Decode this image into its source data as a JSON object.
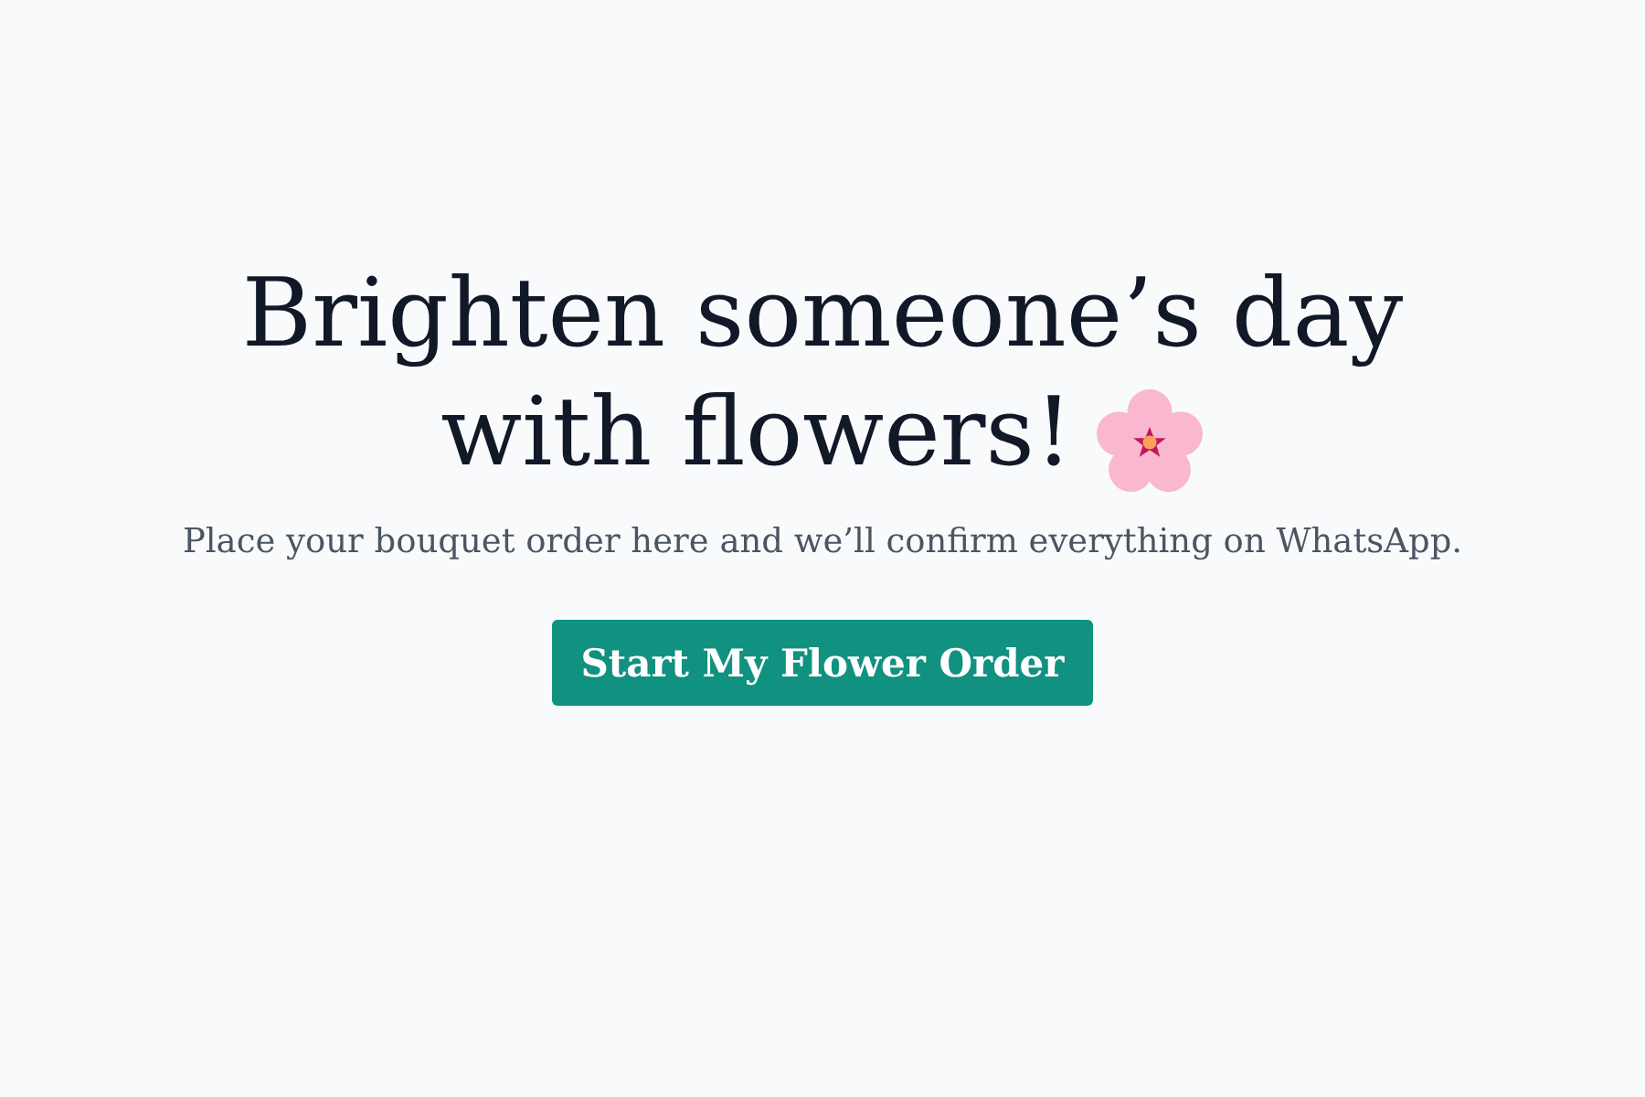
{
  "hero": {
    "headline_lines": [
      "Brighten someone’s day",
      "with flowers!"
    ],
    "subtitle": "Place your bouquet order here and we’ll confirm everything on WhatsApp."
  },
  "button": {
    "label": "Start My Flower Order"
  }
}
